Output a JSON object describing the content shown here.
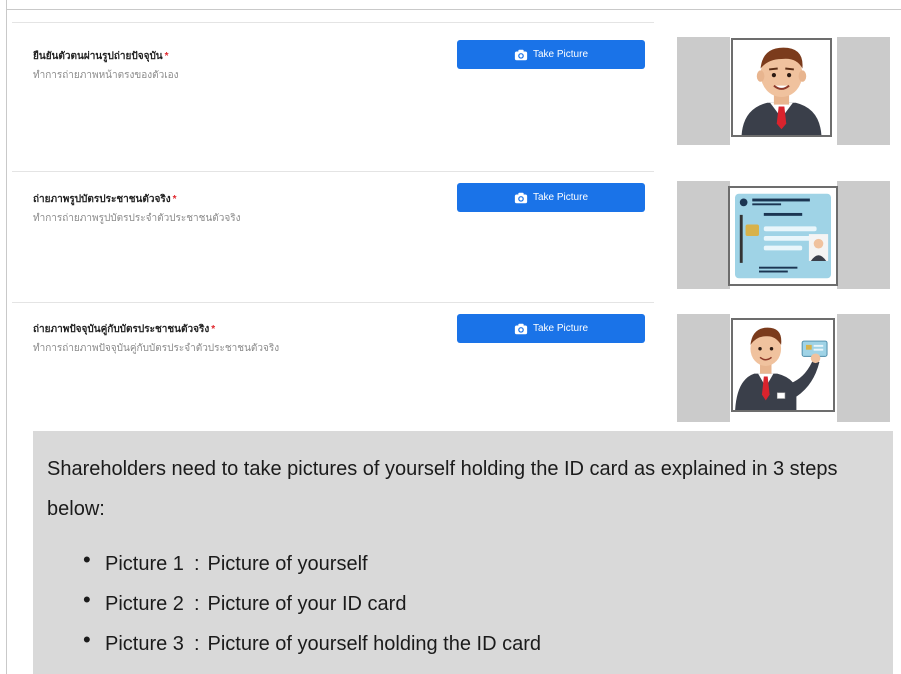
{
  "button_label": "Take Picture",
  "rows": [
    {
      "title": "ยืนยันตัวตนผ่านรูปถ่ายปัจจุบัน",
      "required": "*",
      "desc": "ทำการถ่ายภาพหน้าตรงของตัวเอง"
    },
    {
      "title": "ถ่ายภาพรูปบัตรประชาชนตัวจริง",
      "required": "*",
      "desc": "ทำการถ่ายภาพรูปบัตรประจำตัวประชาชนตัวจริง"
    },
    {
      "title": "ถ่ายภาพปัจจุบันคู่กับบัตรประชาชนตัวจริง",
      "required": "*",
      "desc": "ทำการถ่ายภาพปัจจุบันคู่กับบัตรประจำตัวประชาชนตัวจริง"
    }
  ],
  "note": {
    "intro": "Shareholders need to take pictures of yourself holding the ID card as explained in 3 steps below:",
    "items": [
      {
        "label": "Picture 1",
        "sep": ":",
        "text": "Picture of yourself"
      },
      {
        "label": "Picture 2",
        "sep": ":",
        "text": "Picture of your ID card"
      },
      {
        "label": "Picture 3",
        "sep": ":",
        "text": "Picture of yourself holding the ID card"
      }
    ]
  },
  "colors": {
    "primary": "#1a73e8",
    "required": "#e0282e",
    "panel": "#cbcbcb",
    "note_bg": "#d9d9d9"
  },
  "icons": {
    "button": "camera-icon"
  }
}
